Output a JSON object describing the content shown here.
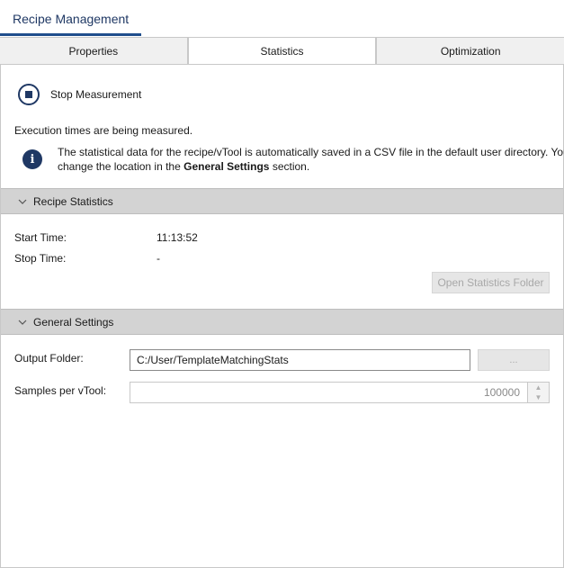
{
  "app": {
    "title": "Recipe Management"
  },
  "tabs": [
    {
      "label": "Properties",
      "active": false
    },
    {
      "label": "Statistics",
      "active": true
    },
    {
      "label": "Optimization",
      "active": false
    }
  ],
  "measurement": {
    "stop_label": "Stop Measurement",
    "status_text": "Execution times are being measured.",
    "info_line1": "The statistical data for the recipe/vTool is automatically saved in a CSV file in the default user directory. You",
    "info_line2_prefix": "change the location in the ",
    "info_line2_bold": "General Settings",
    "info_line2_suffix": " section."
  },
  "recipe_statistics": {
    "header": "Recipe Statistics",
    "start_time_label": "Start Time:",
    "start_time_value": "11:13:52",
    "stop_time_label": "Stop Time:",
    "stop_time_value": "-",
    "open_folder_label": "Open Statistics Folder"
  },
  "general_settings": {
    "header": "General Settings",
    "output_folder_label": "Output Folder:",
    "output_folder_value": "C:/User/TemplateMatchingStats",
    "browse_label": "...",
    "samples_label": "Samples per vTool:",
    "samples_value": "100000"
  },
  "icons": {
    "stop": "stop-circle-icon",
    "info": "info-icon",
    "chevron": "chevron-down-icon"
  },
  "colors": {
    "accent": "#1f3864",
    "section_header_bg": "#d3d3d3",
    "disabled_text": "#a8a8a8"
  }
}
